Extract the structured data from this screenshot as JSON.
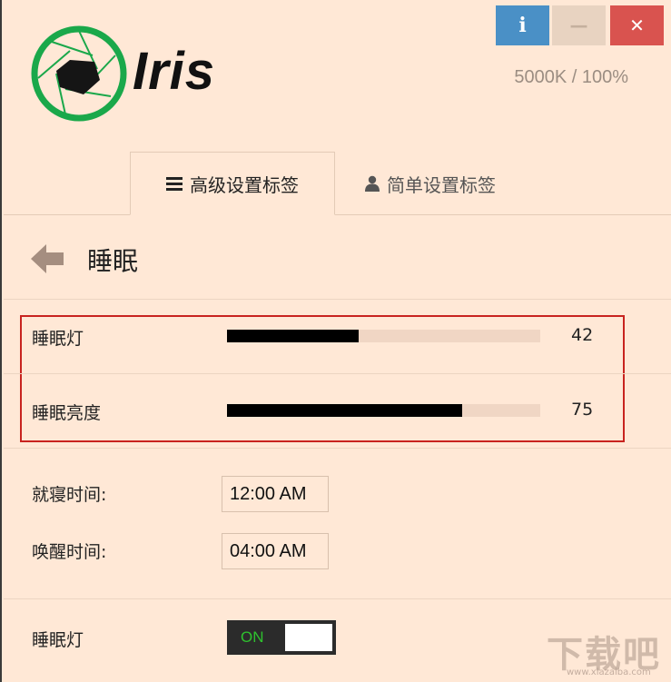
{
  "window": {
    "info_glyph": "i",
    "minimize_glyph": "—",
    "close_glyph": "✕",
    "colors": {
      "background": "#ffe8d6",
      "info": "#4a90c6",
      "close": "#d9534f"
    }
  },
  "logo": {
    "text": "Iris",
    "icon": "aperture-icon"
  },
  "status": "5000K / 100%",
  "tabs": [
    {
      "label": "高级设置标签",
      "icon": "menu-icon",
      "active": true
    },
    {
      "label": "简单设置标签",
      "icon": "user-icon",
      "active": false
    }
  ],
  "section": {
    "title": "睡眠",
    "back_icon": "arrow-left-icon"
  },
  "sliders": [
    {
      "label": "睡眠灯",
      "value": "42",
      "fraction": 0.42
    },
    {
      "label": "睡眠亮度",
      "value": "75",
      "fraction": 0.75
    }
  ],
  "times": [
    {
      "label": "就寝时间:",
      "value": "12:00 AM"
    },
    {
      "label": "唤醒时间:",
      "value": "04:00 AM"
    }
  ],
  "toggle": {
    "label": "睡眠灯",
    "state": "ON"
  },
  "watermark": {
    "text": "下载吧",
    "sub": "www.xiazaiba.com"
  }
}
